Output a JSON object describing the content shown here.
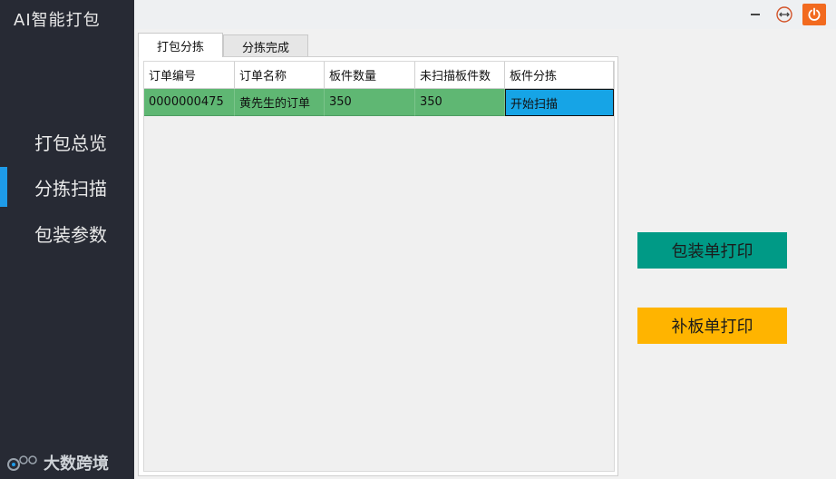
{
  "app": {
    "title": "AI智能打包"
  },
  "sidebar": {
    "items": [
      {
        "label": "打包总览",
        "active": false
      },
      {
        "label": "分拣扫描",
        "active": true
      },
      {
        "label": "包装参数",
        "active": false
      }
    ],
    "logo_text": "大数跨境"
  },
  "window_controls": {
    "minimize_icon": "minimize-icon",
    "restore_icon": "resize-icon",
    "close_icon": "power-icon",
    "close_color": "#f26a1f"
  },
  "tabs": [
    {
      "label": "打包分拣",
      "active": true
    },
    {
      "label": "分拣完成",
      "active": false
    }
  ],
  "table": {
    "columns": [
      "订单编号",
      "订单名称",
      "板件数量",
      "未扫描板件数",
      "板件分拣"
    ],
    "rows": [
      {
        "order_no": "0000000475",
        "order_name": "黄先生的订单",
        "board_count": "350",
        "unscanned": "350",
        "action": "开始扫描"
      }
    ]
  },
  "actions": {
    "pack_print": "包装单打印",
    "supplement_print": "补板单打印"
  },
  "colors": {
    "sidebar_bg": "#272a34",
    "active_indicator": "#1e9be8",
    "row_highlight": "#5fb773",
    "action_cell": "#16a4e6",
    "pack_print_btn": "#009a86",
    "supplement_print_btn": "#ffb400"
  }
}
